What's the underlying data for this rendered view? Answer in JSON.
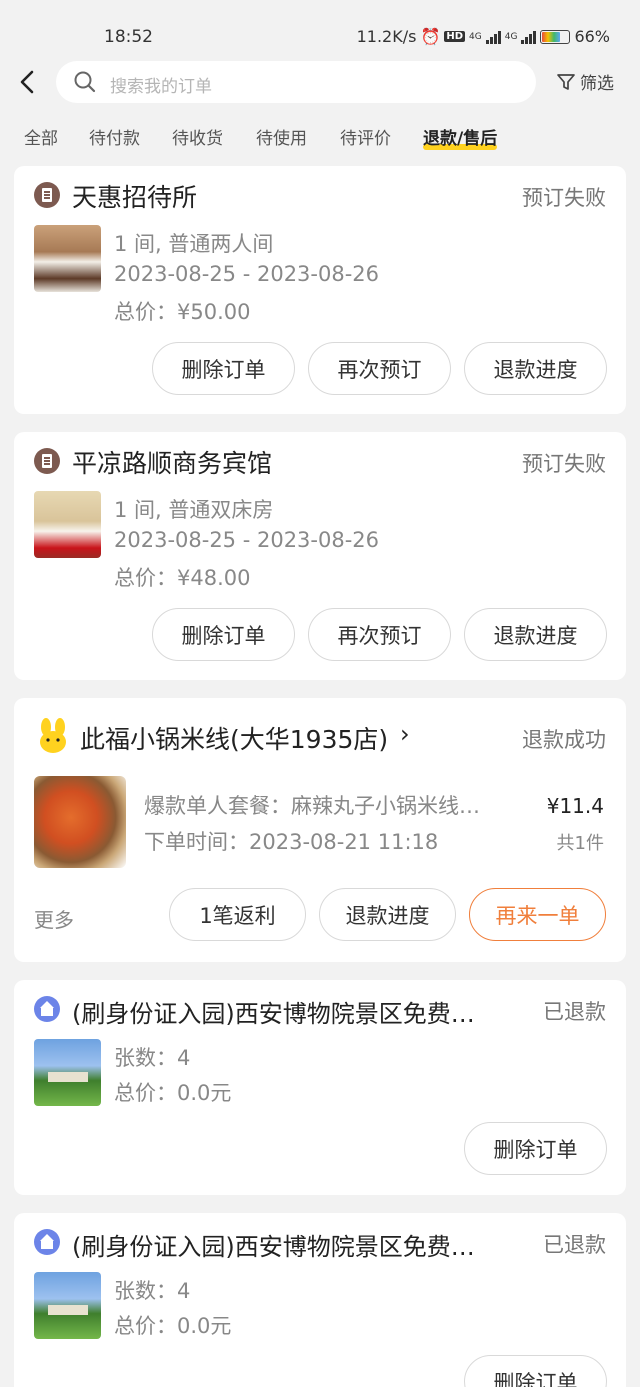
{
  "status_bar": {
    "time": "18:52",
    "net_speed": "11.2K/s",
    "hd": "HD",
    "net1": "4G",
    "net2": "4G",
    "battery": "66%"
  },
  "search": {
    "placeholder": "搜索我的订单",
    "filter_label": "筛选"
  },
  "tabs": [
    {
      "label": "全部"
    },
    {
      "label": "待付款"
    },
    {
      "label": "待收货"
    },
    {
      "label": "待使用"
    },
    {
      "label": "待评价"
    },
    {
      "label": "退款/售后"
    }
  ],
  "orders": [
    {
      "title": "天惠招待所",
      "status": "预订失败",
      "room": "1 间, 普通两人间",
      "dates": "2023-08-25 - 2023-08-26",
      "price": "总价：¥50.00",
      "buttons": [
        "删除订单",
        "再次预订",
        "退款进度"
      ]
    },
    {
      "title": "平凉路顺商务宾馆",
      "status": "预订失败",
      "room": "1 间, 普通双床房",
      "dates": "2023-08-25 - 2023-08-26",
      "price": "总价：¥48.00",
      "buttons": [
        "删除订单",
        "再次预订",
        "退款进度"
      ]
    },
    {
      "title": "此福小锅米线(大华1935店)",
      "status": "退款成功",
      "item": "爆款单人套餐：麻辣丸子小锅米线…",
      "order_time": "下单时间：2023-08-21 11:18",
      "price": "¥11.4",
      "qty": "共1件",
      "more": "更多",
      "buttons": [
        "1笔返利",
        "退款进度",
        "再来一单"
      ]
    },
    {
      "title": "(刷身份证入园)西安博物院景区免费…",
      "status": "已退款",
      "count": "张数：4",
      "price": "总价：0.0元",
      "buttons": [
        "删除订单"
      ]
    },
    {
      "title": "(刷身份证入园)西安博物院景区免费…",
      "status": "已退款",
      "count": "张数：4",
      "price": "总价：0.0元",
      "buttons": [
        "删除订单"
      ]
    }
  ],
  "colors": {
    "accent": "#f07f3c",
    "tab_underline": "#ffd21f"
  }
}
